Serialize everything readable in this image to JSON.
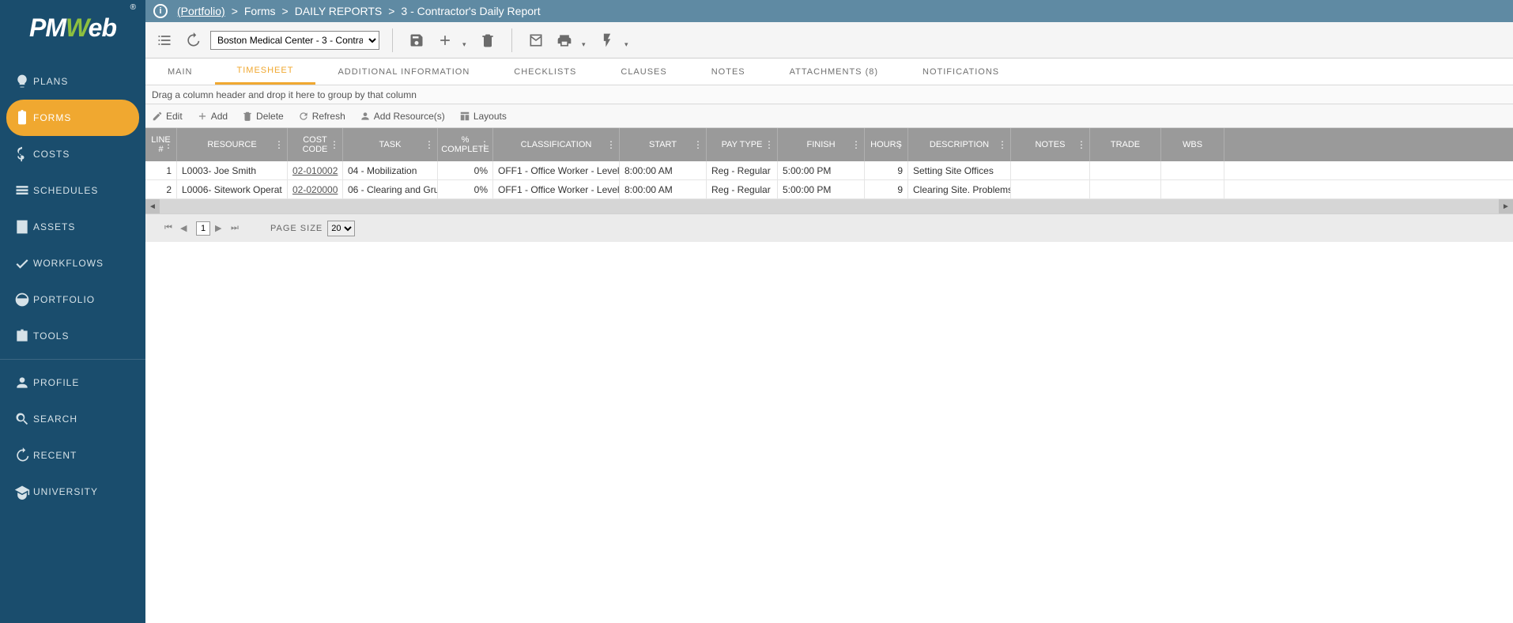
{
  "logo": {
    "text_pre": "PM",
    "text_w": "W",
    "text_post": "eb",
    "reg": "®"
  },
  "sidebar": {
    "items": [
      {
        "label": "PLANS",
        "icon": "lightbulb"
      },
      {
        "label": "FORMS",
        "icon": "clipboard",
        "active": true
      },
      {
        "label": "COSTS",
        "icon": "dollar"
      },
      {
        "label": "SCHEDULES",
        "icon": "bars"
      },
      {
        "label": "ASSETS",
        "icon": "building"
      },
      {
        "label": "WORKFLOWS",
        "icon": "check"
      },
      {
        "label": "PORTFOLIO",
        "icon": "globe"
      },
      {
        "label": "TOOLS",
        "icon": "briefcase"
      }
    ],
    "items2": [
      {
        "label": "PROFILE",
        "icon": "person"
      },
      {
        "label": "SEARCH",
        "icon": "search"
      },
      {
        "label": "RECENT",
        "icon": "history"
      },
      {
        "label": "UNIVERSITY",
        "icon": "grad"
      }
    ]
  },
  "breadcrumb": {
    "portfolio": "(Portfolio)",
    "parts": [
      "Forms",
      "DAILY REPORTS",
      "3 - Contractor's Daily Report"
    ]
  },
  "toolbar": {
    "selector_value": "Boston Medical Center - 3 - Contrac"
  },
  "tabs": [
    {
      "label": "MAIN"
    },
    {
      "label": "TIMESHEET",
      "active": true
    },
    {
      "label": "ADDITIONAL INFORMATION"
    },
    {
      "label": "CHECKLISTS"
    },
    {
      "label": "CLAUSES"
    },
    {
      "label": "NOTES"
    },
    {
      "label": "ATTACHMENTS (8)"
    },
    {
      "label": "NOTIFICATIONS"
    }
  ],
  "group_hint": "Drag a column header and drop it here to group by that column",
  "grid_toolbar": {
    "edit": "Edit",
    "add": "Add",
    "delete": "Delete",
    "refresh": "Refresh",
    "add_res": "Add Resource(s)",
    "layouts": "Layouts"
  },
  "columns": {
    "line": "LINE #",
    "resource": "RESOURCE",
    "cost": "COST CODE",
    "task": "TASK",
    "pct": "% COMPLETE",
    "class": "CLASSIFICATION",
    "start": "START",
    "pay": "PAY TYPE",
    "finish": "FINISH",
    "hours": "HOURS",
    "desc": "DESCRIPTION",
    "notes": "NOTES",
    "trade": "TRADE",
    "wbs": "WBS"
  },
  "rows": [
    {
      "line": "1",
      "resource": "L0003- Joe Smith",
      "cost": "02-010002",
      "task": "04 - Mobilization",
      "pct": "0%",
      "class": "OFF1 - Office Worker - Level",
      "start": "8:00:00 AM",
      "pay": "Reg - Regular",
      "finish": "5:00:00 PM",
      "hours": "9",
      "desc": "Setting Site Offices",
      "notes": "",
      "trade": "",
      "wbs": ""
    },
    {
      "line": "2",
      "resource": "L0006- Sitework Operat",
      "cost": "02-020000",
      "task": "06 - Clearing and Gru",
      "pct": "0%",
      "class": "OFF1 - Office Worker - Level",
      "start": "8:00:00 AM",
      "pay": "Reg - Regular",
      "finish": "5:00:00 PM",
      "hours": "9",
      "desc": "Clearing Site. Problems",
      "notes": "",
      "trade": "",
      "wbs": ""
    }
  ],
  "pager": {
    "page": "1",
    "pagesize_label": "PAGE SIZE",
    "pagesize": "20"
  }
}
